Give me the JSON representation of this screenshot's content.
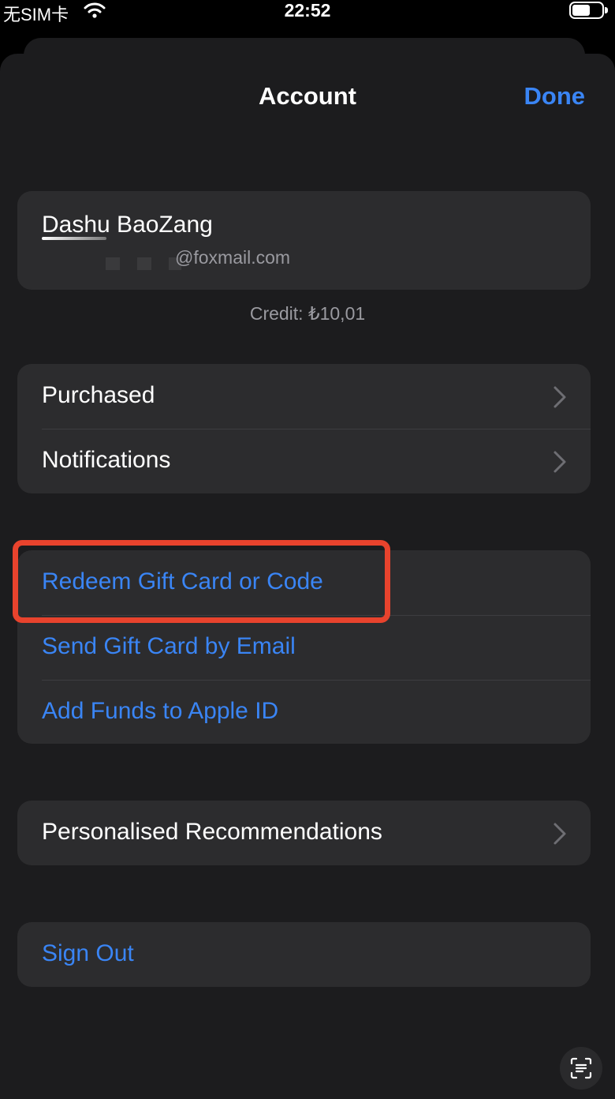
{
  "status_bar": {
    "carrier": "无SIM卡",
    "time": "22:52"
  },
  "nav": {
    "title": "Account",
    "done": "Done"
  },
  "profile": {
    "name": "Dashu BaoZang",
    "email": "@foxmail.com"
  },
  "credit": "Credit: ₺10,01",
  "group1": [
    {
      "label": "Purchased"
    },
    {
      "label": "Notifications"
    }
  ],
  "group2": [
    {
      "label": "Redeem Gift Card or Code"
    },
    {
      "label": "Send Gift Card by Email"
    },
    {
      "label": "Add Funds to Apple ID"
    }
  ],
  "group3": [
    {
      "label": "Personalised Recommendations"
    }
  ],
  "sign_out": "Sign Out",
  "colors": {
    "accent": "#3a85f5",
    "highlight": "#e8432d",
    "background": "#1c1c1e",
    "cell": "#2c2c2e"
  }
}
